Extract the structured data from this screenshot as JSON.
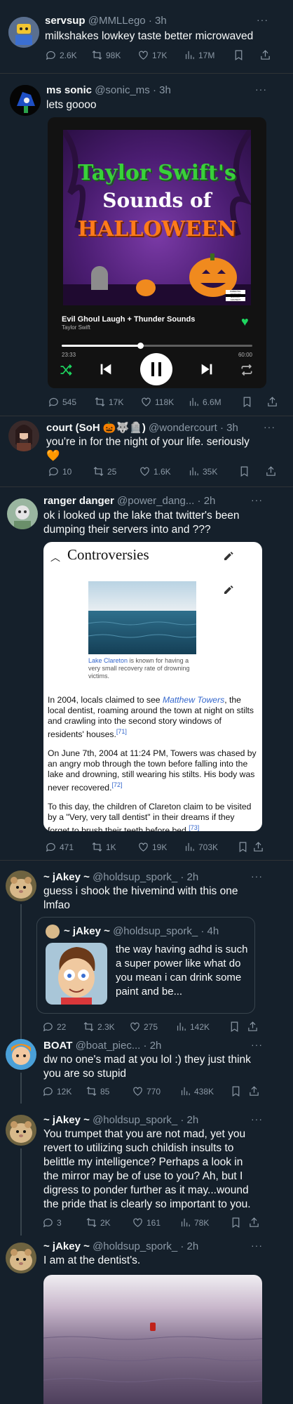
{
  "tweets": [
    {
      "name": "servsup",
      "handle": "@MMLLego",
      "time": "3h",
      "text": "milkshakes lowkey taste better microwaved",
      "replies": "2.6K",
      "reposts": "98K",
      "likes": "17K",
      "views": "17M"
    },
    {
      "name": "ms sonic",
      "handle": "@sonic_ms",
      "time": "3h",
      "text": "lets goooo",
      "replies": "545",
      "reposts": "17K",
      "likes": "118K",
      "views": "6.6M",
      "player": {
        "album_title_1": "Taylor Swift's",
        "album_title_2": "Sounds of",
        "album_title_3": "HALLOWEEN",
        "track": "Evil Ghoul Laugh + Thunder Sounds",
        "artist": "Taylor Swift",
        "elapsed": "23:33",
        "duration": "60:00",
        "progress": 0.41,
        "advisory": "PARENTAL ADVISORY EXPLICIT CONTENT"
      }
    },
    {
      "name": "court (SoH",
      "name_emoji": "🎃🐺🪦)",
      "handle": "@wondercourt",
      "time": "3h",
      "text": "you're in for the night of your life. seriously",
      "text_emoji": "🧡",
      "replies": "10",
      "reposts": "25",
      "likes": "1.6K",
      "views": "35K"
    },
    {
      "name": "ranger danger",
      "handle": "@power_dang...",
      "time": "2h",
      "text": "ok i looked up the lake that twitter's been dumping their servers into and ???",
      "replies": "471",
      "reposts": "1K",
      "likes": "19K",
      "views": "703K",
      "wiki": {
        "heading": "Controversies",
        "caption_link": "Lake Clareton",
        "caption_rest": " is known for having a very small recovery rate of drowning victims.",
        "p1_a": "In 2004, locals claimed to see ",
        "p1_link": "Matthew Towers",
        "p1_b": ", the local dentist, roaming around the town at night on stilts and crawling into the second story windows of residents' houses.",
        "p1_ref": "[71]",
        "p2": "On June 7th, 2004 at 11:24 PM, Towers was chased by an angry mob through the town before falling into the lake and drowning, still wearing his stilts.  His body was never recovered.",
        "p2_ref": "[72]",
        "p3": "To this day, the children of Clareton claim to be visited by a \"Very, very tall dentist\" in their dreams if they forget to brush their teeth before bed.",
        "p3_ref": "[73]"
      }
    },
    {
      "name": "~ jAkey ~",
      "handle": "@holdsup_spork_",
      "time": "2h",
      "text": "guess i shook the hivemind with this one lmfao",
      "replies": "22",
      "reposts": "2.3K",
      "likes": "275",
      "views": "142K",
      "quote": {
        "name": "~ jAkey ~",
        "handle": "@holdsup_spork_",
        "time": "4h",
        "text": "the way having adhd is such a super power like what do you mean i can drink some paint and be..."
      }
    },
    {
      "name": "BOAT",
      "handle": "@boat_piec...",
      "time": "2h",
      "text": "dw no one's mad at you lol :) they just think you are so stupid",
      "replies": "12K",
      "reposts": "85",
      "likes": "770",
      "views": "438K"
    },
    {
      "name": "~ jAkey ~",
      "handle": "@holdsup_spork_",
      "time": "2h",
      "text": "You trumpet that you are not mad, yet you revert to utilizing such childish insults to belittle my intelligence? Perhaps a look in the mirror may be of use to you? Ah, but I digress to ponder further as it may...wound the pride that is clearly so important to you.",
      "replies": "3",
      "reposts": "2K",
      "likes": "161",
      "views": "78K"
    },
    {
      "name": "~ jAkey ~",
      "handle": "@holdsup_spork_",
      "time": "2h",
      "text": "I am at the dentist's."
    }
  ],
  "colors": {
    "bg": "#15202b",
    "muted": "#8b98a5",
    "link": "#1d9bf0",
    "spotify_green": "#1ed760"
  }
}
